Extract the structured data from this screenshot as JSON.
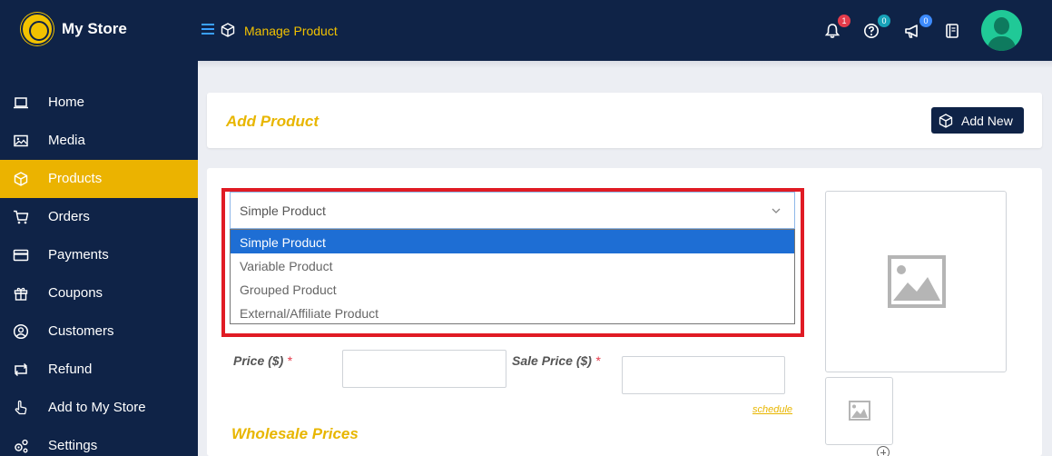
{
  "header": {
    "store_name": "My Store",
    "breadcrumb": "Manage Product",
    "notifications_count": "1",
    "help_count": "0",
    "announcements_count": "0"
  },
  "sidebar": {
    "items": [
      {
        "label": "Home",
        "icon": "laptop-icon"
      },
      {
        "label": "Media",
        "icon": "image-icon"
      },
      {
        "label": "Products",
        "icon": "cube-icon",
        "active": true
      },
      {
        "label": "Orders",
        "icon": "cart-icon"
      },
      {
        "label": "Payments",
        "icon": "credit-card-icon"
      },
      {
        "label": "Coupons",
        "icon": "gift-icon"
      },
      {
        "label": "Customers",
        "icon": "user-circle-icon"
      },
      {
        "label": "Refund",
        "icon": "refund-icon"
      },
      {
        "label": "Add to My Store",
        "icon": "hand-pointer-icon"
      },
      {
        "label": "Settings",
        "icon": "cogs-icon"
      }
    ]
  },
  "panel": {
    "title": "Add Product",
    "add_new_label": "Add New"
  },
  "product_type": {
    "selected": "Simple Product",
    "options": [
      "Simple Product",
      "Variable Product",
      "Grouped Product",
      "External/Affiliate Product"
    ]
  },
  "fields": {
    "price_label": "Price ($)",
    "sale_price_label": "Sale Price ($)",
    "required_mark": "*",
    "schedule_link": "schedule",
    "wholesale_title": "Wholesale Prices"
  },
  "colors": {
    "navy": "#0f2347",
    "accent": "#ebb300",
    "highlight": "#e01b24",
    "selected_option": "#1e6ed4"
  }
}
